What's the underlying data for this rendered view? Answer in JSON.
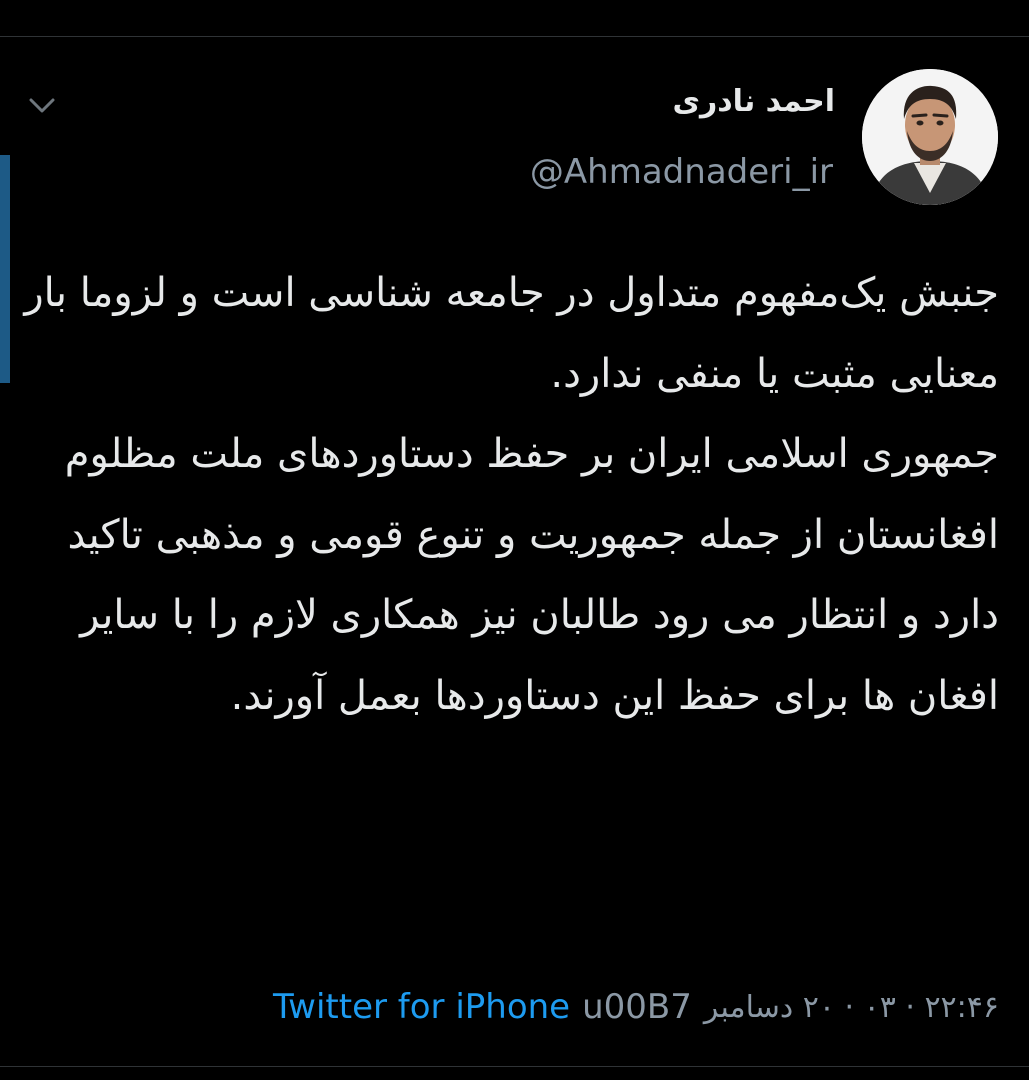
{
  "tweet": {
    "author": {
      "display_name": "احمد نادری",
      "handle": "@Ahmadnaderi_ir",
      "avatar_icon": "profile-photo"
    },
    "text": "جنبش یک‌مفهوم متداول در جامعه شناسی است و لزوما بار معنایی مثبت یا منفی ندارد.\nجمهوری اسلامی ایران بر حفظ دستاوردهای ملت مظلوم افغانستان از جمله جمهوریت و تنوع قومی و مذهبی تاکید دارد و انتظار می رود طالبان نیز همکاری لازم را با سایر افغان ها برای حفظ این دستاوردها بعمل آورند.",
    "timestamp": "۲۲:۴۶ · ۰۳ · ۲۰ دسامبر",
    "separator": "u00B7",
    "source": "Twitter for iPhone",
    "more_icon": "chevron-down-icon"
  },
  "colors": {
    "background": "#000000",
    "text": "#e7e9ea",
    "secondary_text": "#8b98a5",
    "link": "#1d9bf0",
    "thread_accent": "#1d5a86",
    "divider": "#2f3336"
  }
}
